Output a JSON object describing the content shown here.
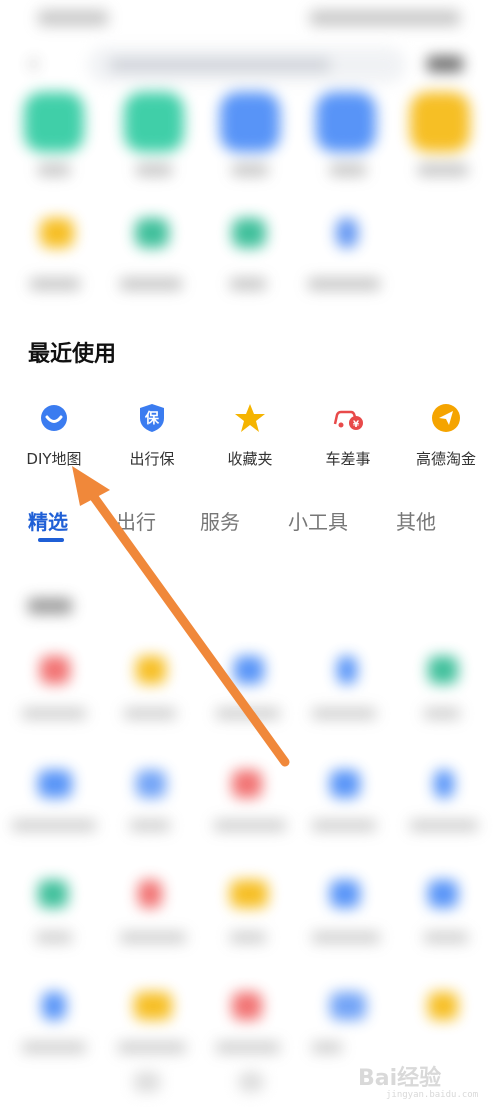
{
  "recent": {
    "title": "最近使用",
    "items": [
      {
        "label": "DIY地图",
        "icon": "smile-map-icon",
        "color": "#3b7cf0"
      },
      {
        "label": "出行保",
        "icon": "shield-bao-icon",
        "color": "#3b7cf0"
      },
      {
        "label": "收藏夹",
        "icon": "star-icon",
        "color": "#f5b400"
      },
      {
        "label": "车差事",
        "icon": "car-yen-icon",
        "color": "#e84a4a"
      },
      {
        "label": "高德淘金",
        "icon": "paper-plane-icon",
        "color": "#f5a400"
      }
    ]
  },
  "tabs": [
    {
      "label": "精选",
      "active": true
    },
    {
      "label": "出行",
      "active": false
    },
    {
      "label": "服务",
      "active": false
    },
    {
      "label": "小工具",
      "active": false
    },
    {
      "label": "其他",
      "active": false
    }
  ],
  "watermark": {
    "text": "Bai经验",
    "sub": "jingyan.baidu.com"
  },
  "colors": {
    "accent": "#1f5fd6",
    "arrow": "#f0883a"
  }
}
